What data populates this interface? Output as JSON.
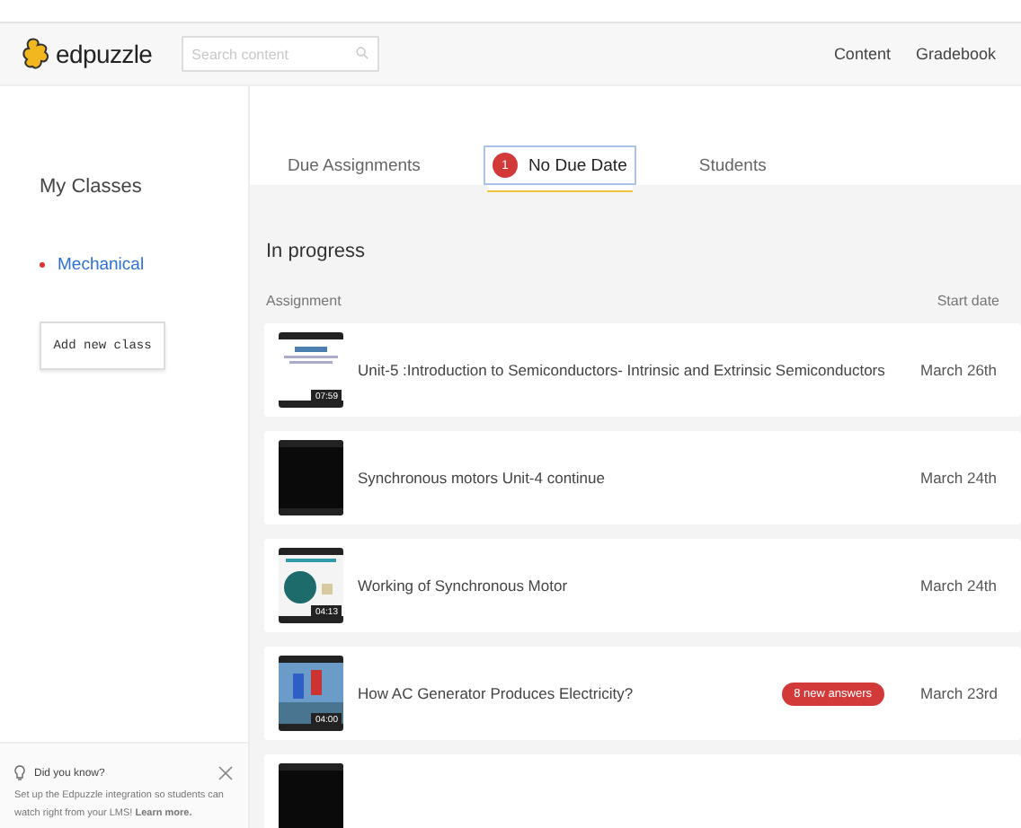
{
  "header": {
    "logo": "edpuzzle",
    "search": {
      "placeholder": "Search content"
    },
    "nav": [
      "Content",
      "Gradebook"
    ]
  },
  "sidebar": {
    "title": "My Classes",
    "classes": [
      {
        "label": "Mechanical",
        "selected": true
      }
    ],
    "add_button": "Add new class",
    "tip": {
      "title": "Did you know?",
      "text": "Set up the Edpuzzle integration so students can watch right from your LMS! **Learn more.**"
    }
  },
  "tabs": [
    {
      "label": "Due Assignments",
      "selected": false
    },
    {
      "label": "No Due Date",
      "selected": true,
      "badge": "1"
    },
    {
      "label": "Students",
      "selected": false
    }
  ],
  "section": {
    "title": "In progress",
    "columns": [
      "Assignment",
      "Start date"
    ]
  },
  "rows": [
    {
      "kind": "full",
      "duration": "07:59",
      "title": "Unit-5 :Introduction to Semiconductors- Intrinsic and Extrinsic Semiconductors",
      "date": "March 26th"
    },
    {
      "kind": "full",
      "title": "Synchronous motors Unit-4 continue",
      "date": "March 24th"
    },
    {
      "kind": "full",
      "duration": "04:13",
      "title": "Working of Synchronous Motor",
      "date": "March 24th"
    },
    {
      "kind": "full",
      "duration": "04:00",
      "title": "How AC Generator Produces Electricity?",
      "badge": "8 new answers",
      "date": "March 23rd"
    },
    {
      "kind": "partial"
    }
  ]
}
